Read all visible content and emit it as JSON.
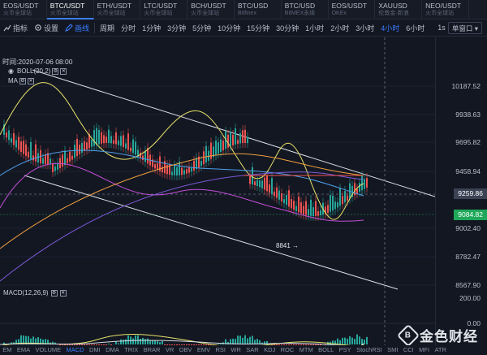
{
  "tickers": [
    {
      "symbol": "EOS/USDT",
      "source": "火币全球站"
    },
    {
      "symbol": "BTC/USDT",
      "source": "火币全球站"
    },
    {
      "symbol": "ETH/USDT",
      "source": "火币全球站"
    },
    {
      "symbol": "LTC/USDT",
      "source": "火币全球站"
    },
    {
      "symbol": "BCH/USDT",
      "source": "火币全球站"
    },
    {
      "symbol": "BTC/USD",
      "source": "Bitfinex"
    },
    {
      "symbol": "BTC/USD",
      "source": "BitMEX永续"
    },
    {
      "symbol": "EOS/USDT",
      "source": "OKEx"
    },
    {
      "symbol": "XAUUSD",
      "source": "伦敦金·新浪"
    },
    {
      "symbol": "NEO/USDT",
      "source": "火币全球站"
    }
  ],
  "toolbar": {
    "indicators_label": "指标",
    "settings_label": "设置",
    "draw_label": "画线",
    "period_label": "周期",
    "periods": [
      "分时",
      "1分钟",
      "3分钟",
      "5分钟",
      "10分钟",
      "15分钟",
      "30分钟",
      "1小时",
      "2小时",
      "3小时",
      "4小时",
      "6小时"
    ],
    "active_period": "4小时",
    "timezone": "1s",
    "window_label": "单窗口"
  },
  "chart": {
    "timestamp": "时间:2020-07-06 08:00",
    "boll_label": "BOLL(20,2)",
    "ma_label": "MA",
    "low_annotation": "8841 →",
    "y_labels": [
      "10187.52",
      "9938.63",
      "9695.82",
      "9458.94",
      "9259.86",
      "9002.40",
      "8782.47",
      "8567.90"
    ],
    "current_price": "9084.82",
    "crosshair_price": "9259.86",
    "macd_label": "MACD(12,26,9)",
    "macd_y_labels": [
      "200.00",
      "0.00"
    ]
  },
  "bottom_tabs": [
    "EMA",
    "VOLUME",
    "MACD",
    "DMI",
    "DMA",
    "TRIX",
    "BRAR",
    "VR",
    "OBV",
    "EMV",
    "RSI",
    "WR",
    "SAR",
    "KDJ",
    "ROC",
    "MTM",
    "BOLL",
    "PSY",
    "StochRSI",
    "SMI",
    "CCI",
    "MFI",
    "ATR"
  ],
  "bottom_tab_first": "EM",
  "active_bottom_tab": "MACD",
  "watermark": {
    "glyph": "B",
    "text": "金色财经"
  },
  "colors": {
    "up": "#26a69a",
    "down": "#ef5350",
    "accent": "#3b7cff",
    "current_price": "#1fa85a"
  }
}
